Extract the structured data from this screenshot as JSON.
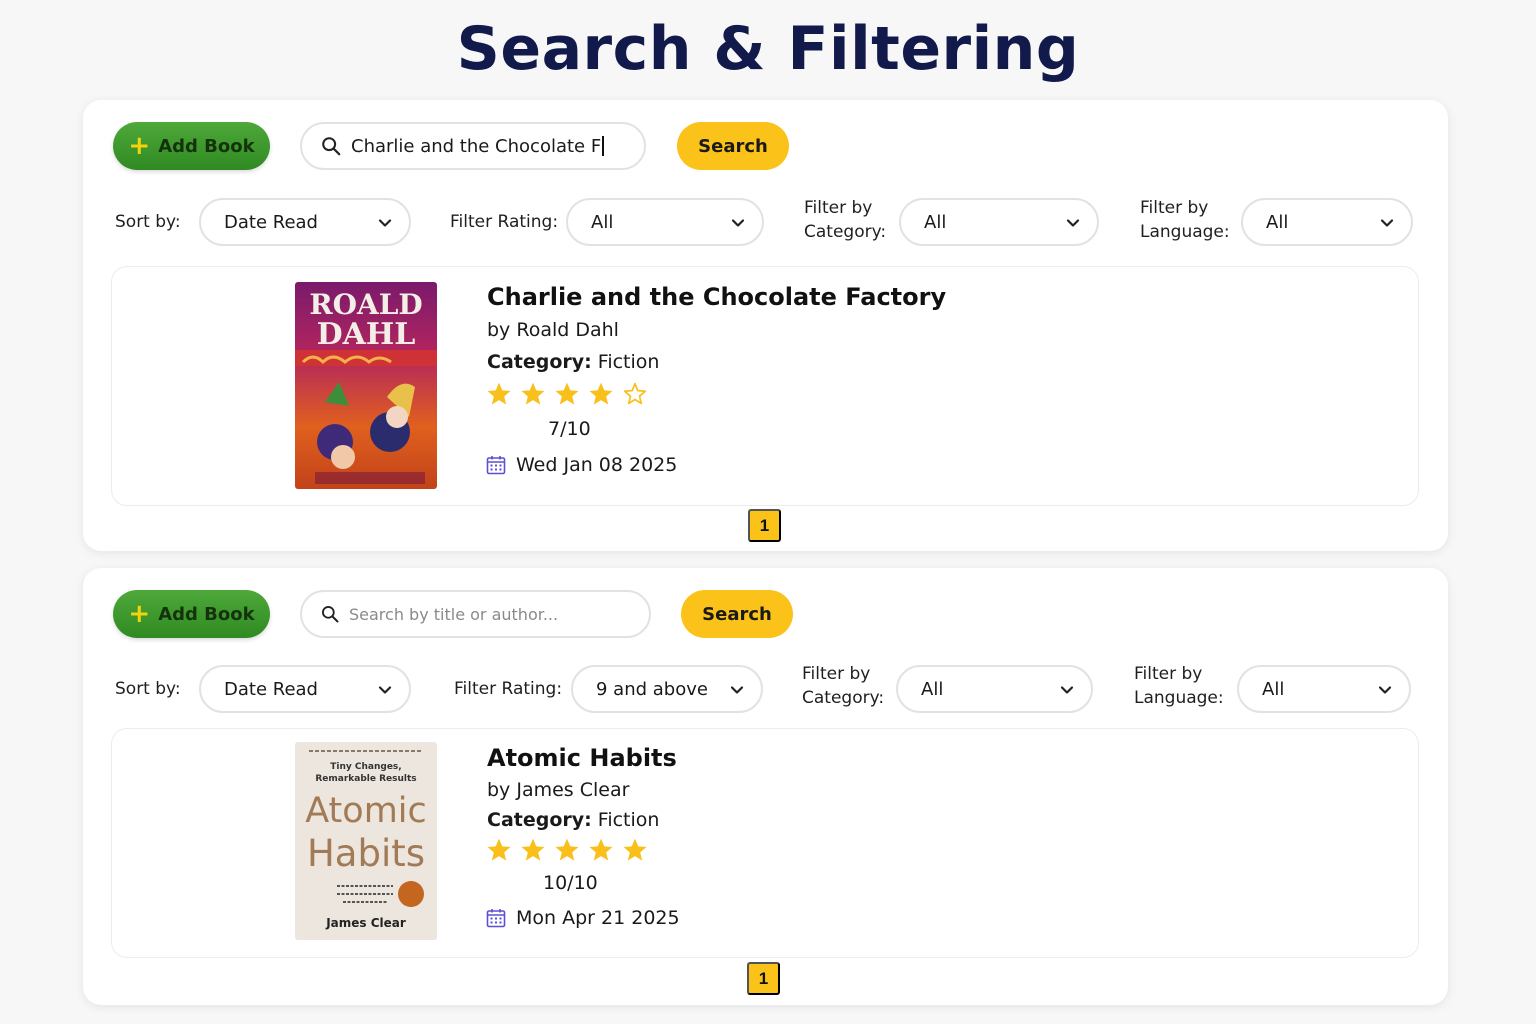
{
  "page_title": "Search & Filtering",
  "colors": {
    "accent_yellow": "#fbc21a",
    "add_green": "#3a9a2c",
    "title_navy": "#111a4a",
    "calendar_purple": "#5b4fd6",
    "star_gold": "#f9bf1a"
  },
  "panels": [
    {
      "add_button": "Add Book",
      "search": {
        "value": "Charlie and the Chocolate F",
        "placeholder": "Search by title or author..."
      },
      "search_button": "Search",
      "filters": {
        "sort_label": "Sort by:",
        "sort_value": "Date Read",
        "rating_label": "Filter Rating:",
        "rating_value": "All",
        "category_label_1": "Filter by",
        "category_label_2": "Category:",
        "category_value": "All",
        "language_label_1": "Filter by",
        "language_label_2": "Language:",
        "language_value": "All"
      },
      "book": {
        "title": "Charlie and the Chocolate Factory",
        "author": "by Roald Dahl",
        "category_label": "Category:",
        "category_value": " Fiction",
        "stars_filled": 4,
        "stars_total": 5,
        "score": "7/10",
        "date": "Wed Jan 08 2025",
        "cover_text_1": "ROALD",
        "cover_text_2": "DAHL"
      },
      "page": "1"
    },
    {
      "add_button": "Add Book",
      "search": {
        "value": "",
        "placeholder": "Search by title or author..."
      },
      "search_button": "Search",
      "filters": {
        "sort_label": "Sort by:",
        "sort_value": "Date Read",
        "rating_label": "Filter Rating:",
        "rating_value": "9 and above",
        "category_label_1": "Filter by",
        "category_label_2": "Category:",
        "category_value": "All",
        "language_label_1": "Filter by",
        "language_label_2": "Language:",
        "language_value": "All"
      },
      "book": {
        "title": "Atomic Habits",
        "author": "by James Clear",
        "category_label": "Category:",
        "category_value": " Fiction",
        "stars_filled": 5,
        "stars_total": 5,
        "score": "10/10",
        "date": "Mon Apr 21 2025",
        "cover_tagline_1": "Tiny Changes,",
        "cover_tagline_2": "Remarkable Results",
        "cover_text_1": "Atomic",
        "cover_text_2": "Habits",
        "cover_author": "James Clear"
      },
      "page": "1"
    }
  ]
}
